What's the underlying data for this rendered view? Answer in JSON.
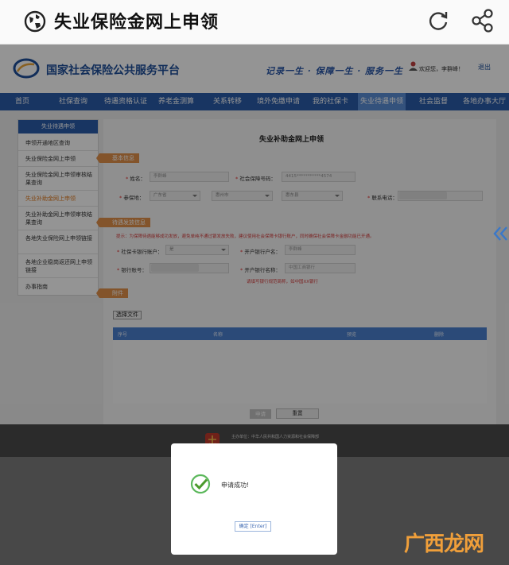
{
  "browser": {
    "title": "失业保险金网上申领"
  },
  "header": {
    "site_name": "国家社会保险公共服务平台",
    "slogan": "记录一生 · 保障一生 · 服务一生",
    "welcome": "欢迎您，李群峰！",
    "logout": "退出"
  },
  "nav": {
    "items": [
      "首页",
      "社保查询",
      "待遇资格认证",
      "养老金测算",
      "关系转移",
      "境外免缴申请",
      "我的社保卡",
      "失业待遇申领",
      "社会监督",
      "各地办事大厅"
    ],
    "active_index": 7
  },
  "sidebar": {
    "title": "失业待遇申领",
    "items": [
      "申领开通地区查询",
      "失业保险金网上申领",
      "失业保险金网上申领审核结果查询",
      "失业补助金网上申领",
      "失业补助金网上申领审核结果查询",
      "各地失业保险网上申领链接",
      "各地企业稳岗返还网上申领链接",
      "办事指南"
    ],
    "active_index": 3
  },
  "form": {
    "title": "失业补助金网上申领",
    "section_basic": "基本信息",
    "name_label": "姓名：",
    "name_value": "李群峰",
    "ssn_label": "社会保障号码：",
    "ssn_value": "4415***********4574",
    "insured_place_label": "参保地：",
    "province_value": "广东省",
    "city_value": "惠州市",
    "district_value": "惠东县",
    "phone_label": "联系电话：",
    "section_payment": "待遇发放信息",
    "payment_tip": "提示：为保障待遇能够成功发放，避免单纯不通过银发放失败，建议使用社会保障卡银行账户，同时确保社会保障卡金融功能已开通。",
    "bank_account_label": "社保卡银行账户：",
    "bank_account_value": "是",
    "account_name_label": "开户银行户名：",
    "account_name_value": "李群峰",
    "account_no_label": "银行账号：",
    "bank_name_label": "开户银行名称：",
    "bank_name_value": "中国工商银行",
    "bank_hint": "请填写银行规范简称，如中国XX银行",
    "section_attachment": "附件",
    "choose_file": "选择文件",
    "table_headers": [
      "序号",
      "名称",
      "预览",
      "删除"
    ],
    "apply_button": "申请",
    "reset_button": "重置"
  },
  "footer": {
    "line1": "主办单位：中华人民共和国人力资源和社会保障部",
    "line2": "0号"
  },
  "modal": {
    "message": "申请成功!",
    "ok_button": "确定 [Enter]"
  },
  "watermark": "广西龙网"
}
